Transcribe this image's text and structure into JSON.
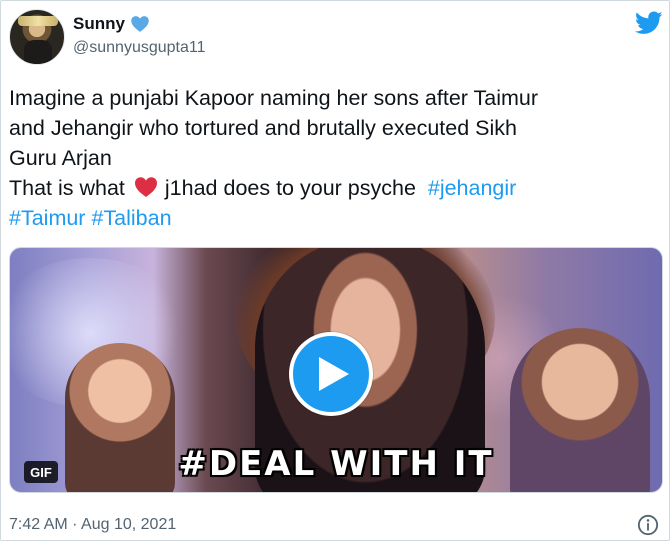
{
  "user": {
    "display_name": "Sunny",
    "handle": "@sunnyusgupta11",
    "verified_badge": "heart-badge-icon",
    "avatar": "avatar"
  },
  "brand": {
    "logo_icon": "twitter-bird-icon",
    "accent": "#1d9bf0"
  },
  "tweet": {
    "line1": "Imagine a punjabi Kapoor naming her sons after Taimur",
    "line2": "and Jehangir who tortured and brutally executed Sikh",
    "line3": "Guru Arjan",
    "line4_before": "That is what",
    "line4_emoji": "red-heart-icon",
    "line4_after": "j1had does to your psyche",
    "hashtags": [
      "#jehangir",
      "#Taimur",
      "#Taliban"
    ]
  },
  "media": {
    "type_badge": "GIF",
    "caption": "#DEAL WITH IT",
    "play_icon": "play-icon"
  },
  "footer": {
    "time": "7:42 AM · Aug 10, 2021",
    "info_icon": "info-icon"
  }
}
